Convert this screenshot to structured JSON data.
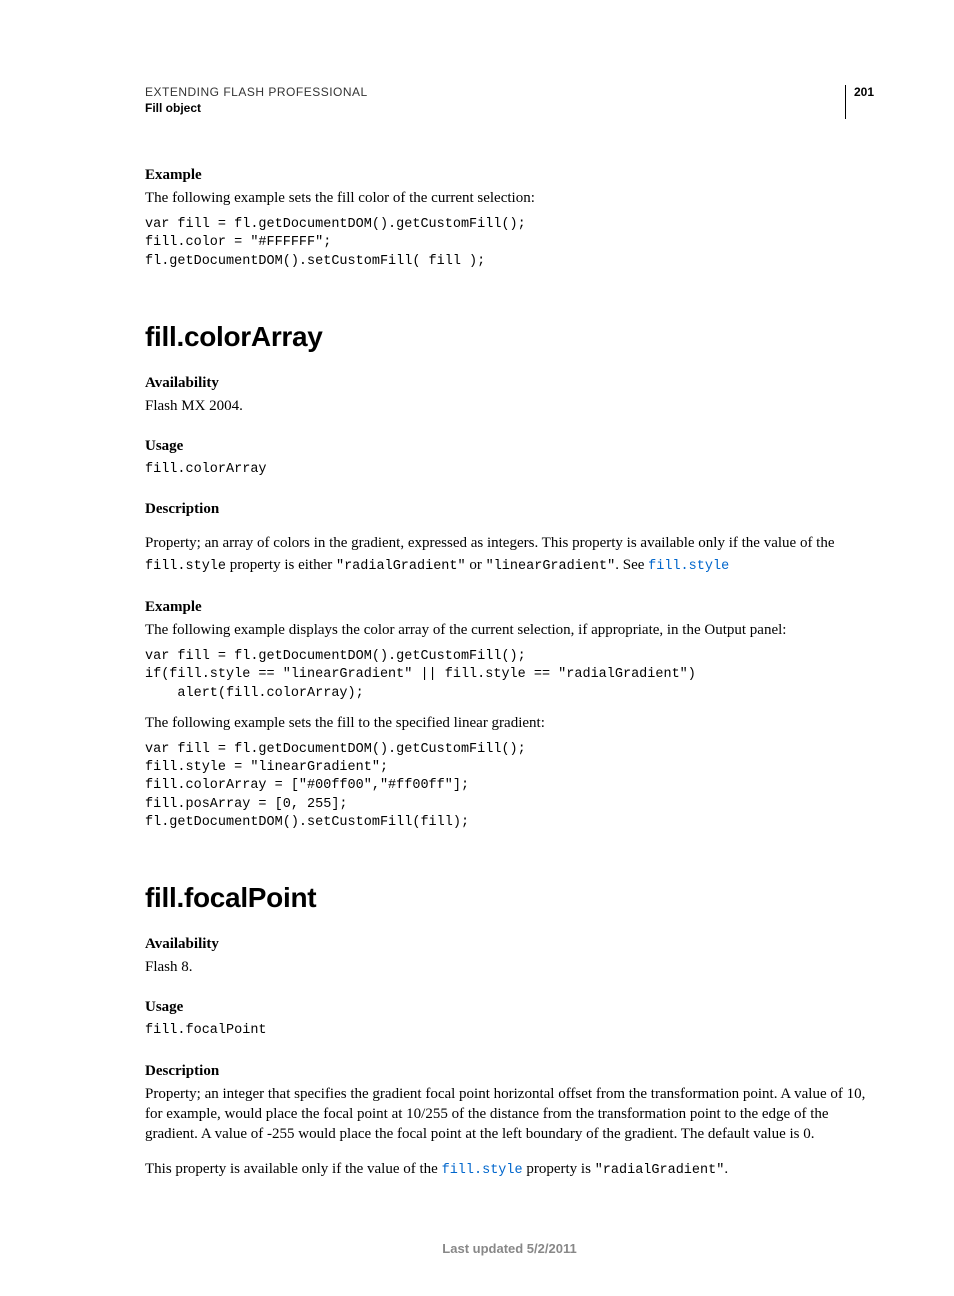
{
  "header": {
    "title": "EXTENDING FLASH PROFESSIONAL",
    "subtitle": "Fill object",
    "page_number": "201"
  },
  "section1": {
    "example_label": "Example",
    "example_intro": "The following example sets the fill color of the current selection:",
    "code": "var fill = fl.getDocumentDOM().getCustomFill();\nfill.color = \"#FFFFFF\";\nfl.getDocumentDOM().setCustomFill( fill );"
  },
  "colorArray": {
    "heading": "fill.colorArray",
    "availability_label": "Availability",
    "availability_text": "Flash MX 2004.",
    "usage_label": "Usage",
    "usage_code": "fill.colorArray",
    "description_label": "Description",
    "desc_part1": "Property; an array of colors in the gradient, expressed as integers. This property is available only if the value of the ",
    "desc_code1": "fill.style",
    "desc_part2": " property is either ",
    "desc_code2": "\"radialGradient\"",
    "desc_part3": " or ",
    "desc_code3": "\"linearGradient\"",
    "desc_part4": ". See ",
    "desc_link": "fill.style",
    "example_label": "Example",
    "example_intro1": "The following example displays the color array of the current selection, if appropriate, in the Output panel:",
    "code1": "var fill = fl.getDocumentDOM().getCustomFill();\nif(fill.style == \"linearGradient\" || fill.style == \"radialGradient\")\n    alert(fill.colorArray);",
    "example_intro2": "The following example sets the fill to the specified linear gradient:",
    "code2": "var fill = fl.getDocumentDOM().getCustomFill();\nfill.style = \"linearGradient\";\nfill.colorArray = [\"#00ff00\",\"#ff00ff\"];\nfill.posArray = [0, 255];\nfl.getDocumentDOM().setCustomFill(fill);"
  },
  "focalPoint": {
    "heading": "fill.focalPoint",
    "availability_label": "Availability",
    "availability_text": "Flash 8.",
    "usage_label": "Usage",
    "usage_code": "fill.focalPoint",
    "description_label": "Description",
    "desc_para1": "Property; an integer that specifies the gradient focal point horizontal offset from the transformation point. A value of 10, for example, would place the focal point at 10/255 of the distance from the transformation point to the edge of the gradient. A value of -255 would place the focal point at the left boundary of the gradient. The default value is 0.",
    "desc_part2a": "This property is available only if the value of the ",
    "desc_link": "fill.style",
    "desc_part2b": " property is ",
    "desc_code": "\"radialGradient\"",
    "desc_part2c": "."
  },
  "footer": {
    "text": "Last updated 5/2/2011"
  }
}
